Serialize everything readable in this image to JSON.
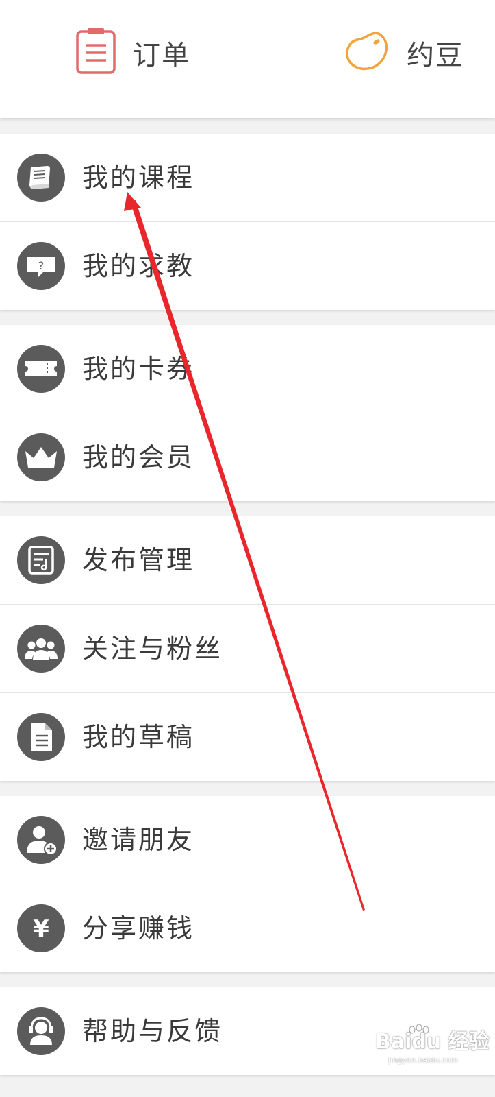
{
  "header": {
    "orders": {
      "label": "订单",
      "icon": "clipboard-list-icon",
      "color": "#e26a6a"
    },
    "beans": {
      "label": "约豆",
      "icon": "bean-icon",
      "color": "#f0a43a"
    }
  },
  "menu": {
    "groups": [
      [
        {
          "label": "我的课程",
          "icon": "book-icon"
        },
        {
          "label": "我的求教",
          "icon": "question-bubble-icon"
        }
      ],
      [
        {
          "label": "我的卡券",
          "icon": "ticket-icon"
        },
        {
          "label": "我的会员",
          "icon": "crown-icon"
        }
      ],
      [
        {
          "label": "发布管理",
          "icon": "publish-document-icon"
        },
        {
          "label": "关注与粉丝",
          "icon": "people-group-icon"
        },
        {
          "label": "我的草稿",
          "icon": "draft-file-icon"
        }
      ],
      [
        {
          "label": "邀请朋友",
          "icon": "user-add-icon"
        },
        {
          "label": "分享赚钱",
          "icon": "yuan-icon"
        }
      ],
      [
        {
          "label": "帮助与反馈",
          "icon": "headset-support-icon"
        }
      ]
    ],
    "icon_circle_color": "#5b5b5b"
  },
  "annotation": {
    "arrow_color": "#e8262b"
  },
  "watermark": {
    "brand": "Baidu 经验",
    "url": "jingyan.baidu.com"
  }
}
